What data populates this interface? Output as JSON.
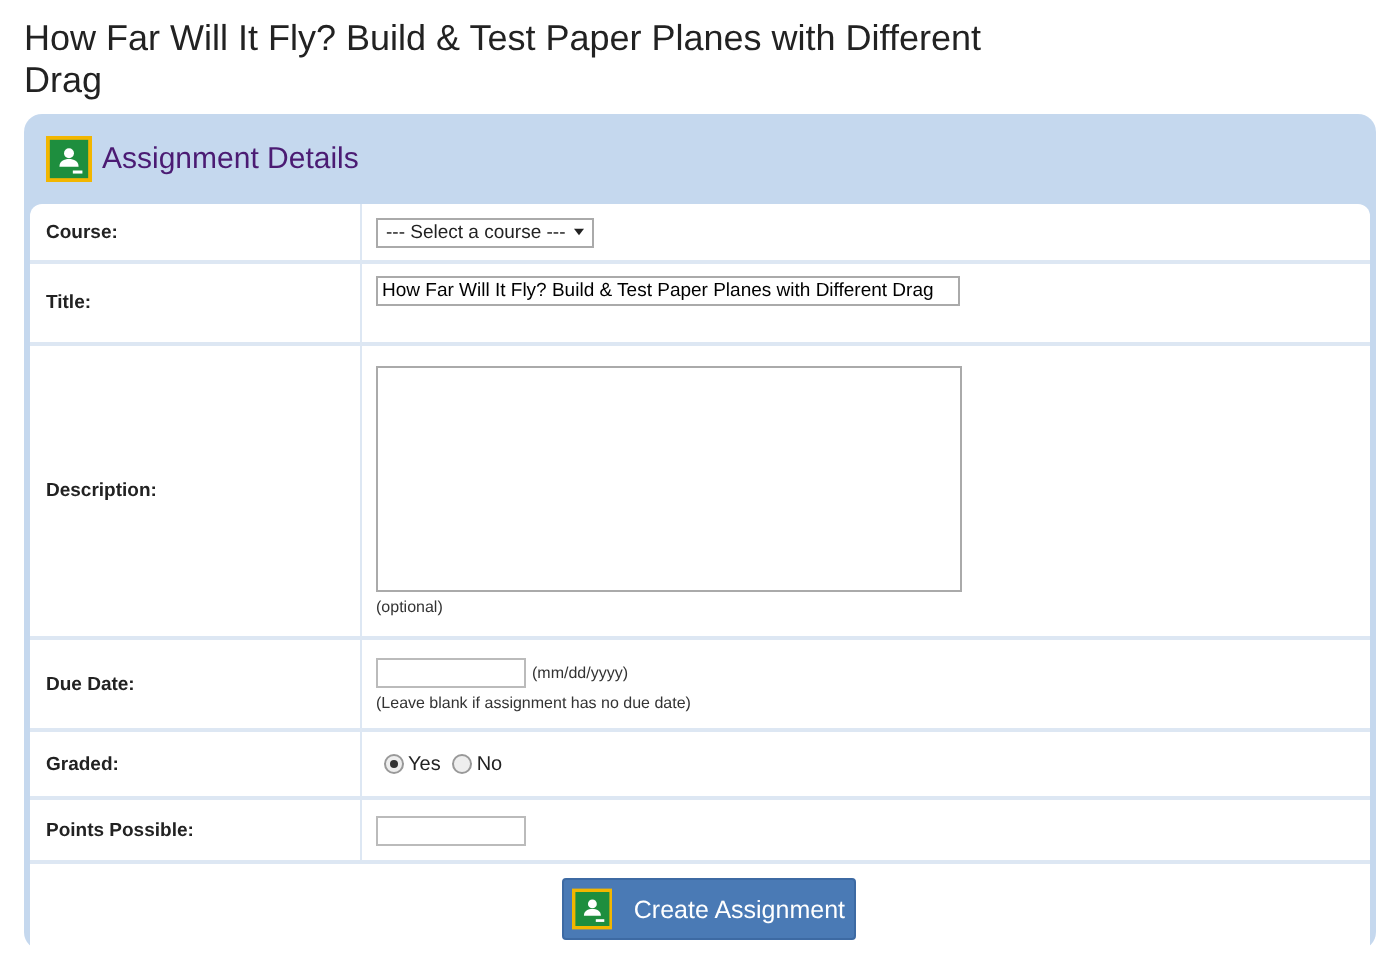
{
  "page_title": "How Far Will It Fly? Build & Test Paper Planes with Different Drag",
  "panel": {
    "title": "Assignment Details"
  },
  "fields": [
    {
      "kind": "select",
      "label": "Course:",
      "value": "--- Select a course ---"
    },
    {
      "kind": "text",
      "label": "Title:",
      "value": "How Far Will It Fly? Build & Test Paper Planes with Different Drag"
    },
    {
      "kind": "textarea",
      "label": "Description:",
      "note": "(optional)"
    },
    {
      "kind": "date",
      "label": "Due Date:",
      "format": "(mm/dd/yyyy)",
      "note": "(Leave blank if assignment has no due date)"
    },
    {
      "kind": "radio",
      "label": "Graded:",
      "options": [
        {
          "label": "Yes",
          "selected": true
        },
        {
          "label": "No",
          "selected": false
        }
      ]
    },
    {
      "kind": "short",
      "label": "Points Possible:"
    }
  ],
  "submit": {
    "label": "Create Assignment"
  }
}
